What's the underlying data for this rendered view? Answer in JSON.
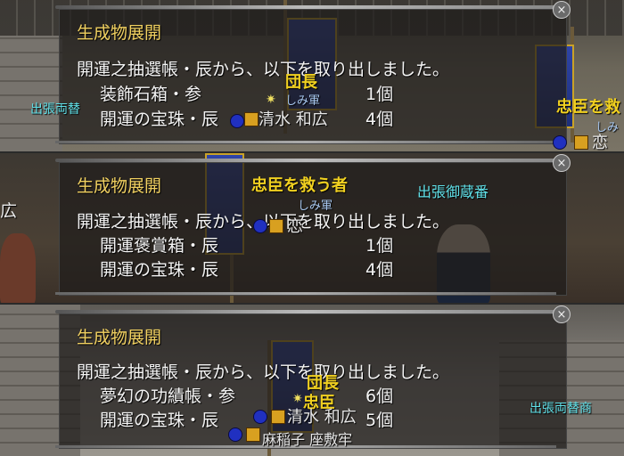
{
  "close_glyph": "×",
  "panels": [
    {
      "title": "生成物展開",
      "message": "開運之抽選帳・辰から、以下を取り出しました。",
      "items": [
        {
          "name": "装飾石箱・参",
          "qty": "1個"
        },
        {
          "name": "開運の宝珠・辰",
          "qty": "4個"
        }
      ],
      "world": {
        "guild_title": "団長",
        "guild_sub": "しみ軍",
        "player_name": "清水 和広",
        "npc_left": "出張両替",
        "npc_right": "忠臣を救",
        "right_sub": "しみ",
        "right_name": "恋"
      }
    },
    {
      "title": "生成物展開",
      "message": "開運之抽選帳・辰から、以下を取り出しました。",
      "items": [
        {
          "name": "開運褒賞箱・辰",
          "qty": "1個"
        },
        {
          "name": "開運の宝珠・辰",
          "qty": "4個"
        }
      ],
      "world": {
        "quest_name": "忠臣を救う者",
        "npc_name": "出張御蔵番",
        "guild_sub": "しみ軍",
        "player_name": "恋",
        "left_fragment": "広"
      }
    },
    {
      "title": "生成物展開",
      "message": "開運之抽選帳・辰から、以下を取り出しました。",
      "items": [
        {
          "name": "夢幻の功績帳・参",
          "qty": "6個"
        },
        {
          "name": "開運の宝珠・辰",
          "qty": "5個"
        }
      ],
      "world": {
        "guild_title": "団長",
        "guild_title2": "忠臣",
        "player_name": "清水 和広",
        "npc_name": "出張両替商",
        "bottom_name": "麻稲子 座敷牢"
      }
    }
  ]
}
